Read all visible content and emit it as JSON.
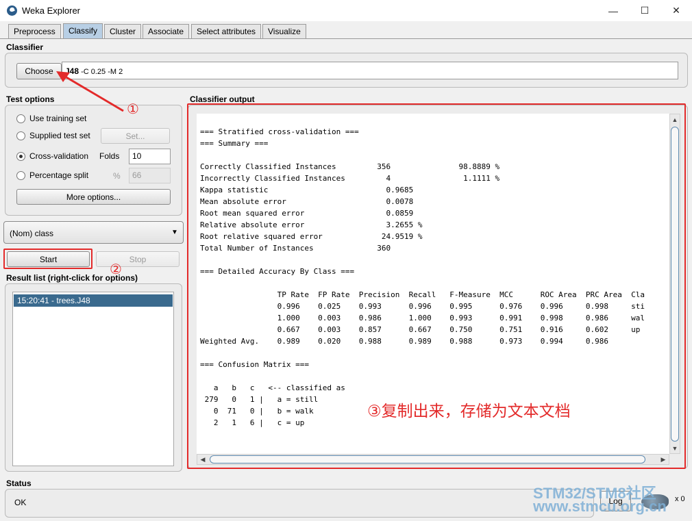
{
  "window": {
    "title": "Weka Explorer",
    "controls": {
      "minimize": "—",
      "maximize": "☐",
      "close": "✕"
    }
  },
  "tabs": [
    {
      "label": "Preprocess",
      "active": false
    },
    {
      "label": "Classify",
      "active": true
    },
    {
      "label": "Cluster",
      "active": false
    },
    {
      "label": "Associate",
      "active": false
    },
    {
      "label": "Select attributes",
      "active": false
    },
    {
      "label": "Visualize",
      "active": false
    }
  ],
  "classifier": {
    "section_title": "Classifier",
    "choose_label": "Choose",
    "name": "J48",
    "options": " -C 0.25 -M 2"
  },
  "test_options": {
    "section_title": "Test options",
    "use_training_set": "Use training set",
    "supplied_test_set": "Supplied test set",
    "set_button": "Set...",
    "cross_validation": "Cross-validation",
    "folds_label": "Folds",
    "folds_value": "10",
    "percentage_split": "Percentage split",
    "percent_symbol": "%",
    "percent_value": "66",
    "more_options": "More options...",
    "selected": "cross_validation"
  },
  "class_selector": {
    "value": "(Nom) class",
    "arrow": "▼"
  },
  "actions": {
    "start_label": "Start",
    "stop_label": "Stop"
  },
  "result_list": {
    "title": "Result list (right-click for options)",
    "items": [
      {
        "label": "15:20:41 - trees.J48",
        "selected": true
      }
    ]
  },
  "output": {
    "title": "Classifier output",
    "lines": [
      "=== Stratified cross-validation ===",
      "=== Summary ===",
      "",
      "Correctly Classified Instances         356               98.8889 %",
      "Incorrectly Classified Instances         4                1.1111 %",
      "Kappa statistic                          0.9685",
      "Mean absolute error                      0.0078",
      "Root mean squared error                  0.0859",
      "Relative absolute error                  3.2655 %",
      "Root relative squared error             24.9519 %",
      "Total Number of Instances              360",
      "",
      "=== Detailed Accuracy By Class ===",
      "",
      "                 TP Rate  FP Rate  Precision  Recall   F-Measure  MCC      ROC Area  PRC Area  Cla",
      "                 0.996    0.025    0.993      0.996    0.995      0.976    0.996     0.998     sti",
      "                 1.000    0.003    0.986      1.000    0.993      0.991    0.998     0.986     wal",
      "                 0.667    0.003    0.857      0.667    0.750      0.751    0.916     0.602     up",
      "Weighted Avg.    0.989    0.020    0.988      0.989    0.988      0.973    0.994     0.986",
      "",
      "=== Confusion Matrix ===",
      "",
      "   a   b   c   <-- classified as",
      " 279   0   1 |   a = still",
      "   0  71   0 |   b = walk",
      "   2   1   6 |   c = up"
    ]
  },
  "status": {
    "section_title": "Status",
    "text": "OK",
    "log_label": "Log",
    "count": "x 0"
  },
  "annotations": {
    "marker_1": "①",
    "marker_2": "②",
    "note_3": "③复制出来，存储为文本文档",
    "color": "#e32a2a"
  },
  "watermark": {
    "line1": "STM32/STM8社区",
    "line2": "www.stmcu.org.cn"
  }
}
